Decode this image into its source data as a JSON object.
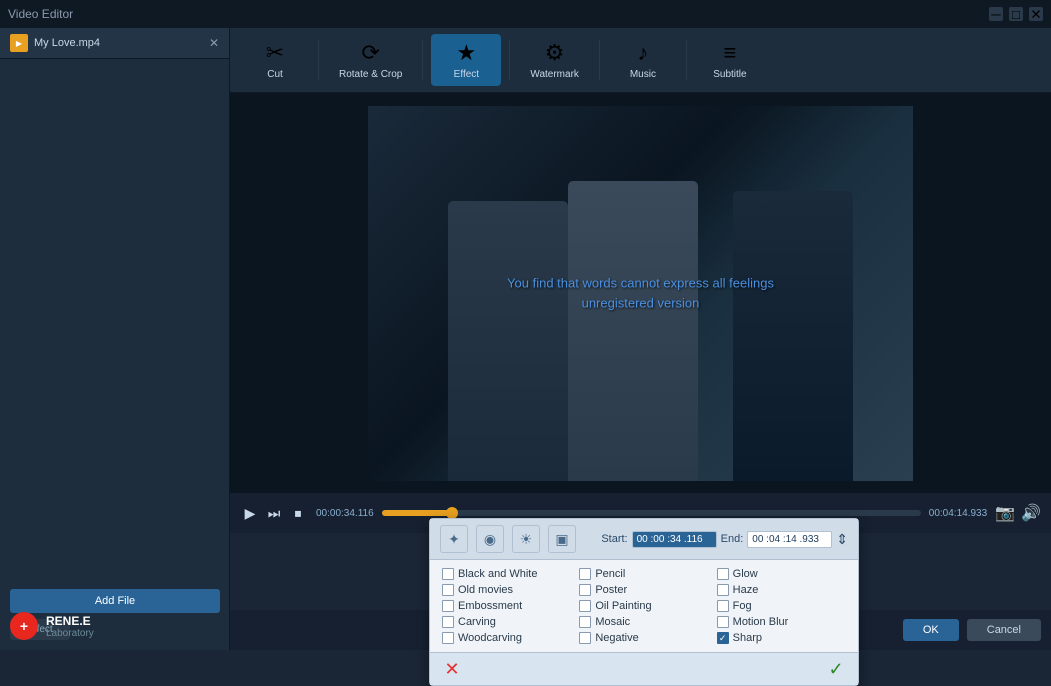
{
  "app": {
    "title": "Video Editor",
    "title_minimize": "─",
    "title_maximize": "□",
    "title_close": "✕"
  },
  "sidebar": {
    "file_item": {
      "name": "My Love.mp4",
      "close_label": "✕"
    },
    "add_file_label": "Add File",
    "effect_label": "Effect",
    "logo": {
      "icon": "+",
      "name": "RENE.E",
      "sub": "Laboratory"
    }
  },
  "toolbar": {
    "items": [
      {
        "id": "cut",
        "icon": "✂",
        "label": "Cut"
      },
      {
        "id": "rotate_crop",
        "icon": "⟳",
        "label": "Rotate & Crop"
      },
      {
        "id": "effect",
        "icon": "★",
        "label": "Effect",
        "active": true
      },
      {
        "id": "watermark",
        "icon": "⚙",
        "label": "Watermark"
      },
      {
        "id": "music",
        "icon": "♪",
        "label": "Music"
      },
      {
        "id": "subtitle",
        "icon": "≡",
        "label": "Subtitle"
      }
    ]
  },
  "video": {
    "subtitle_line1": "You find that words cannot express all feelings",
    "subtitle_line2": "unregistered version"
  },
  "timeline": {
    "current_time": "00:00:34.116",
    "range_label": "00:00:34.116–00:04:14.933",
    "end_time": "00:04:14.933"
  },
  "effects_panel": {
    "tools": [
      {
        "id": "magic",
        "icon": "✦",
        "active": false
      },
      {
        "id": "color",
        "icon": "◉",
        "active": false
      },
      {
        "id": "sun",
        "icon": "☀",
        "active": false
      },
      {
        "id": "frame",
        "icon": "▣",
        "active": false
      }
    ],
    "start_label": "Start:",
    "start_value": "00 :00 :34 .116",
    "end_label": "End:",
    "end_value": "00 :04 :14 .933",
    "effects": [
      {
        "id": "black_white",
        "label": "Black and White",
        "checked": false,
        "col": 0
      },
      {
        "id": "pencil",
        "label": "Pencil",
        "checked": false,
        "col": 1
      },
      {
        "id": "glow",
        "label": "Glow",
        "checked": false,
        "col": 2
      },
      {
        "id": "old_movies",
        "label": "Old movies",
        "checked": false,
        "col": 0
      },
      {
        "id": "poster",
        "label": "Poster",
        "checked": false,
        "col": 1
      },
      {
        "id": "haze",
        "label": "Haze",
        "checked": false,
        "col": 2
      },
      {
        "id": "embossment",
        "label": "Embossment",
        "checked": false,
        "col": 0
      },
      {
        "id": "oil_painting",
        "label": "Oil Painting",
        "checked": false,
        "col": 1
      },
      {
        "id": "fog",
        "label": "Fog",
        "checked": false,
        "col": 2
      },
      {
        "id": "carving",
        "label": "Carving",
        "checked": false,
        "col": 0
      },
      {
        "id": "mosaic",
        "label": "Mosaic",
        "checked": false,
        "col": 1
      },
      {
        "id": "motion_blur",
        "label": "Motion Blur",
        "checked": false,
        "col": 2
      },
      {
        "id": "woodcarving",
        "label": "Woodcarving",
        "checked": false,
        "col": 0
      },
      {
        "id": "negative",
        "label": "Negative",
        "checked": false,
        "col": 1
      },
      {
        "id": "sharp",
        "label": "Sharp",
        "checked": true,
        "col": 2
      }
    ],
    "cancel_icon": "✕",
    "ok_icon": "✓"
  },
  "action_buttons": {
    "ok_label": "OK",
    "cancel_label": "Cancel"
  }
}
